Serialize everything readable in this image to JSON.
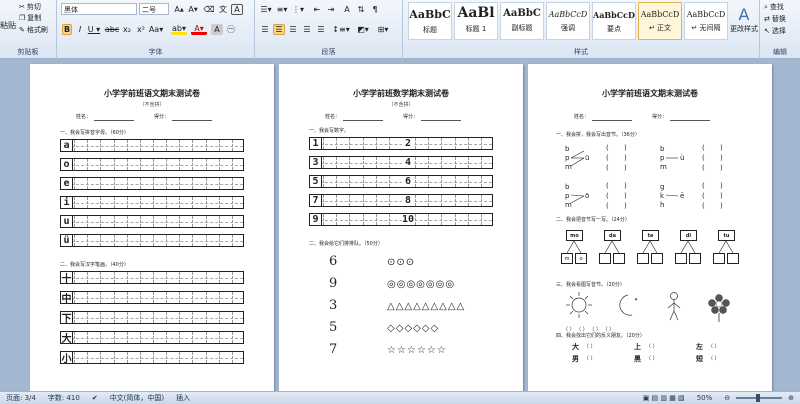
{
  "ribbon": {
    "clipboard": {
      "cut": "剪切",
      "copy": "复制",
      "format_painter": "格式刷",
      "paste": "粘贴",
      "label": "剪贴板"
    },
    "font": {
      "family": "黑体",
      "size": "二号",
      "label": "字体"
    },
    "paragraph": {
      "label": "段落"
    },
    "styles": {
      "label": "样式",
      "items": [
        {
          "preview": "AaBbC",
          "name": "标题"
        },
        {
          "preview": "AaBl",
          "name": "标题 1"
        },
        {
          "preview": "AaBbC",
          "name": "副标题"
        },
        {
          "preview": "AaBbCcD",
          "name": "强调"
        },
        {
          "preview": "AaBbCcD",
          "name": "要点"
        },
        {
          "preview": "AaBbCcD",
          "name": "↵ 正文"
        },
        {
          "preview": "AaBbCcD",
          "name": "↵ 无间隔"
        }
      ],
      "change_styles": "更改样式"
    },
    "editing": {
      "find": "查找",
      "replace": "替换",
      "select": "选择",
      "label": "编辑"
    }
  },
  "pages": [
    {
      "title": "小学学前班语文期末测试卷",
      "subtitle": "（不含拼）",
      "name_label": "姓名：",
      "score_label": "得分：",
      "section1": "一、我会写拼音字母。（60分）",
      "letters": [
        "a",
        "o",
        "e",
        "i",
        "u",
        "ü"
      ],
      "section2": "二、我会写汉字笔画。（40分）",
      "chars": [
        "十",
        "中",
        "下",
        "大",
        "小"
      ]
    },
    {
      "title": "小学学前班数学期末测试卷",
      "subtitle": "（不含拼）",
      "name_label": "姓名：",
      "score_label": "得分：",
      "section1": "一、我会写数字。",
      "left_digits": [
        "1",
        "3",
        "5",
        "7",
        "9"
      ],
      "right_digits": [
        "2",
        "4",
        "6",
        "8",
        "10"
      ],
      "section2": "二、我会给它们排排队。（50分）",
      "counts": [
        {
          "n": "6",
          "shapes": "⊙⊙⊙"
        },
        {
          "n": "9",
          "shapes": "◎◎◎◎◎◎◎"
        },
        {
          "n": "3",
          "shapes": "△△△△△△△△△"
        },
        {
          "n": "5",
          "shapes": "◇◇◇◇◇◇"
        },
        {
          "n": "7",
          "shapes": "☆☆☆☆☆☆"
        }
      ]
    },
    {
      "title": "小学学前班语文期末测试卷",
      "name_label": "姓名：",
      "score_label": "得分：",
      "section1": "一、我会拼，我会写出音节。（36分）",
      "section2": "二、我会把音节写一写。（24分）",
      "syllables": [
        "mo",
        "da",
        "te",
        "di",
        "tu"
      ],
      "sub_letters": [
        "m",
        "o"
      ],
      "section3": "三、我会看图写音节。（20分）",
      "section4": "四、我会找出它们的反义朋友。（20分）",
      "antonyms": [
        {
          "w": "大",
          "p": "（    ）"
        },
        {
          "w": "上",
          "p": "（    ）"
        },
        {
          "w": "左",
          "p": "（    ）"
        },
        {
          "w": "男",
          "p": "（    ）"
        },
        {
          "w": "黑",
          "p": "（    ）"
        },
        {
          "w": "短",
          "p": "（    ）"
        }
      ]
    }
  ],
  "status": {
    "page": "页面: 3/4",
    "words": "字数: 410",
    "lang": "中文(简体，中国)",
    "mode": "插入",
    "zoom": "50%"
  }
}
